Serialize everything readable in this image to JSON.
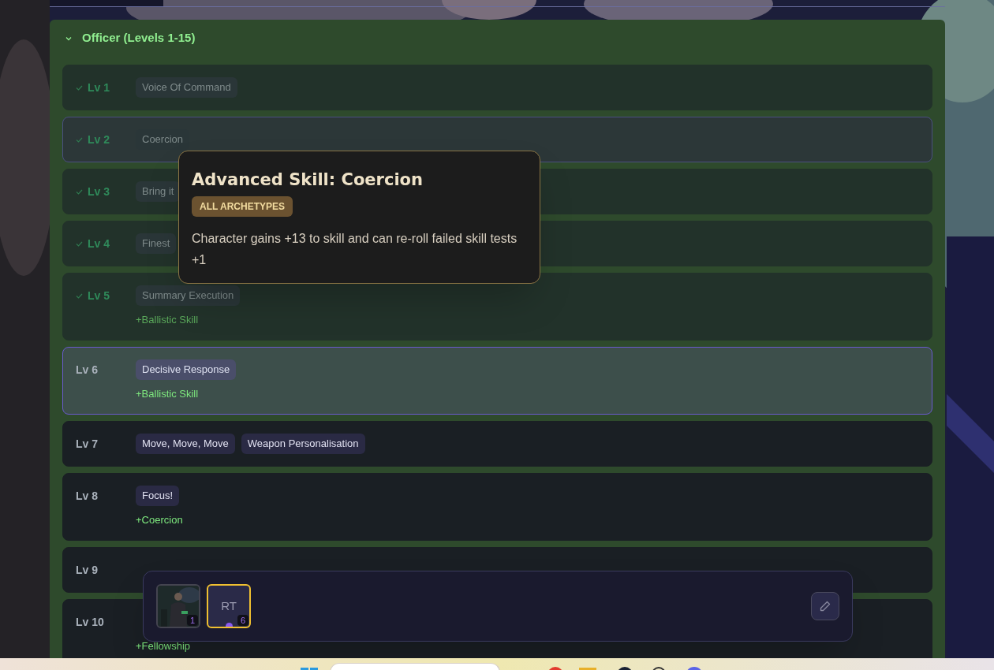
{
  "section": {
    "title": "Officer (Levels 1-15)",
    "expanded": true,
    "levels": [
      {
        "level": "Lv 1",
        "completed": true,
        "selected": false,
        "hovered": false,
        "skills": [
          "Voice Of Command"
        ]
      },
      {
        "level": "Lv 2",
        "completed": true,
        "selected": false,
        "hovered": true,
        "skills": [
          "Coercion"
        ]
      },
      {
        "level": "Lv 3",
        "completed": true,
        "selected": false,
        "hovered": false,
        "skills": [
          "Bring it"
        ]
      },
      {
        "level": "Lv 4",
        "completed": true,
        "selected": false,
        "hovered": false,
        "skills": [
          "Finest"
        ]
      },
      {
        "level": "Lv 5",
        "completed": true,
        "selected": false,
        "hovered": false,
        "skills": [
          "Summary Execution"
        ],
        "bonus": "+Ballistic Skill"
      },
      {
        "level": "Lv 6",
        "completed": false,
        "selected": true,
        "hovered": false,
        "skills": [
          "Decisive Response"
        ],
        "bonus": "+Ballistic Skill"
      },
      {
        "level": "Lv 7",
        "completed": false,
        "selected": false,
        "hovered": false,
        "skills": [
          "Move, Move, Move",
          "Weapon Personalisation"
        ]
      },
      {
        "level": "Lv 8",
        "completed": false,
        "selected": false,
        "hovered": false,
        "skills": [
          "Focus!"
        ],
        "bonus": "+Coercion"
      },
      {
        "level": "Lv 9",
        "completed": false,
        "selected": false,
        "hovered": false
      },
      {
        "level": "Lv 10",
        "completed": false,
        "selected": false,
        "hovered": false,
        "bonus": "+Fellowship"
      }
    ]
  },
  "tooltip": {
    "title": "Advanced Skill: Coercion",
    "tag": "ALL ARCHETYPES",
    "description": "Character gains +13 to skill and can re-roll failed skill tests +1"
  },
  "party_bar": {
    "members": [
      {
        "kind": "portrait",
        "count": "1",
        "selected": false
      },
      {
        "kind": "initials",
        "initials": "RT",
        "count": "6",
        "selected": true
      }
    ]
  }
}
